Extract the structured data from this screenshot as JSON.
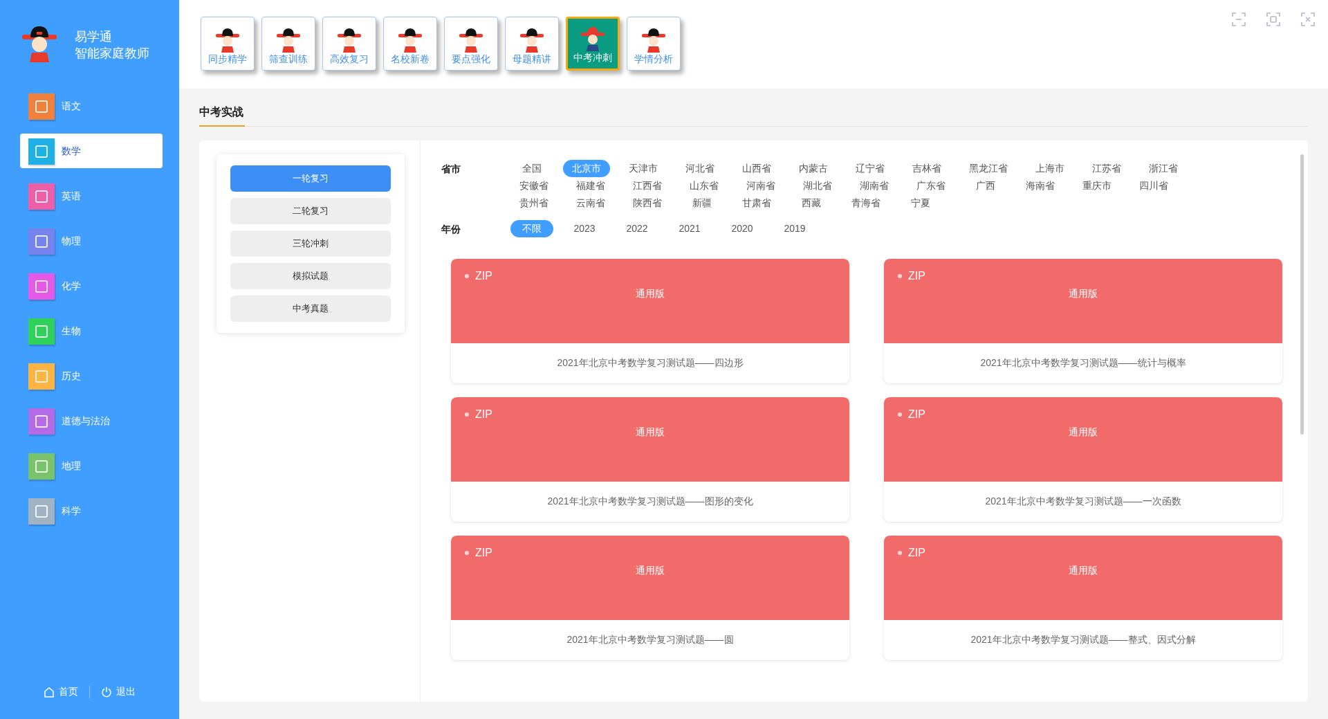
{
  "brand": {
    "name": "易学通",
    "subtitle": "智能家庭教师"
  },
  "subjects": [
    {
      "label": "语文",
      "color": "#f0803a",
      "selected": false
    },
    {
      "label": "数学",
      "color": "#1fb1e6",
      "selected": true
    },
    {
      "label": "英语",
      "color": "#ee5fa7",
      "selected": false
    },
    {
      "label": "物理",
      "color": "#7683ec",
      "selected": false
    },
    {
      "label": "化学",
      "color": "#e659e6",
      "selected": false
    },
    {
      "label": "生物",
      "color": "#2fd15a",
      "selected": false
    },
    {
      "label": "历史",
      "color": "#fdb443",
      "selected": false
    },
    {
      "label": "道德与法治",
      "color": "#b56be6",
      "selected": false
    },
    {
      "label": "地理",
      "color": "#79c36b",
      "selected": false
    },
    {
      "label": "科学",
      "color": "#9fb3c4",
      "selected": false
    }
  ],
  "footer": {
    "home": "首页",
    "logout": "退出"
  },
  "modules": [
    {
      "label": "同步精学",
      "selected": false
    },
    {
      "label": "筛查训练",
      "selected": false
    },
    {
      "label": "高效复习",
      "selected": false
    },
    {
      "label": "名校新卷",
      "selected": false
    },
    {
      "label": "要点强化",
      "selected": false
    },
    {
      "label": "母题精讲",
      "selected": false
    },
    {
      "label": "中考冲刺",
      "selected": true
    },
    {
      "label": "学情分析",
      "selected": false
    }
  ],
  "section_title": "中考实战",
  "stages": [
    {
      "label": "一轮复习",
      "selected": true
    },
    {
      "label": "二轮复习",
      "selected": false
    },
    {
      "label": "三轮冲刺",
      "selected": false
    },
    {
      "label": "模拟试题",
      "selected": false
    },
    {
      "label": "中考真题",
      "selected": false
    }
  ],
  "filters": [
    {
      "label": "省市",
      "options": [
        {
          "label": "全国",
          "selected": false
        },
        {
          "label": "北京市",
          "selected": true
        },
        {
          "label": "天津市",
          "selected": false
        },
        {
          "label": "河北省",
          "selected": false
        },
        {
          "label": "山西省",
          "selected": false
        },
        {
          "label": "内蒙古",
          "selected": false
        },
        {
          "label": "辽宁省",
          "selected": false
        },
        {
          "label": "吉林省",
          "selected": false
        },
        {
          "label": "黑龙江省",
          "selected": false
        },
        {
          "label": "上海市",
          "selected": false
        },
        {
          "label": "江苏省",
          "selected": false
        },
        {
          "label": "浙江省",
          "selected": false
        },
        {
          "label": "安徽省",
          "selected": false
        },
        {
          "label": "福建省",
          "selected": false
        },
        {
          "label": "江西省",
          "selected": false
        },
        {
          "label": "山东省",
          "selected": false
        },
        {
          "label": "河南省",
          "selected": false
        },
        {
          "label": "湖北省",
          "selected": false
        },
        {
          "label": "湖南省",
          "selected": false
        },
        {
          "label": "广东省",
          "selected": false
        },
        {
          "label": "广西",
          "selected": false
        },
        {
          "label": "海南省",
          "selected": false
        },
        {
          "label": "重庆市",
          "selected": false
        },
        {
          "label": "四川省",
          "selected": false
        },
        {
          "label": "贵州省",
          "selected": false
        },
        {
          "label": "云南省",
          "selected": false
        },
        {
          "label": "陕西省",
          "selected": false
        },
        {
          "label": "新疆",
          "selected": false
        },
        {
          "label": "甘肃省",
          "selected": false
        },
        {
          "label": "西藏",
          "selected": false
        },
        {
          "label": "青海省",
          "selected": false
        },
        {
          "label": "宁夏",
          "selected": false
        }
      ]
    },
    {
      "label": "年份",
      "options": [
        {
          "label": "不限",
          "selected": true
        },
        {
          "label": "2023",
          "selected": false
        },
        {
          "label": "2022",
          "selected": false
        },
        {
          "label": "2021",
          "selected": false
        },
        {
          "label": "2020",
          "selected": false
        },
        {
          "label": "2019",
          "selected": false
        }
      ]
    }
  ],
  "resources": [
    {
      "format": "ZIP",
      "edition": "通用版",
      "title": "2021年北京中考数学复习测试题——四边形"
    },
    {
      "format": "ZIP",
      "edition": "通用版",
      "title": "2021年北京中考数学复习测试题——统计与概率"
    },
    {
      "format": "ZIP",
      "edition": "通用版",
      "title": "2021年北京中考数学复习测试题——图形的变化"
    },
    {
      "format": "ZIP",
      "edition": "通用版",
      "title": "2021年北京中考数学复习测试题——一次函数"
    },
    {
      "format": "ZIP",
      "edition": "通用版",
      "title": "2021年北京中考数学复习测试题——圆"
    },
    {
      "format": "ZIP",
      "edition": "通用版",
      "title": "2021年北京中考数学复习测试题——整式、因式分解"
    }
  ]
}
